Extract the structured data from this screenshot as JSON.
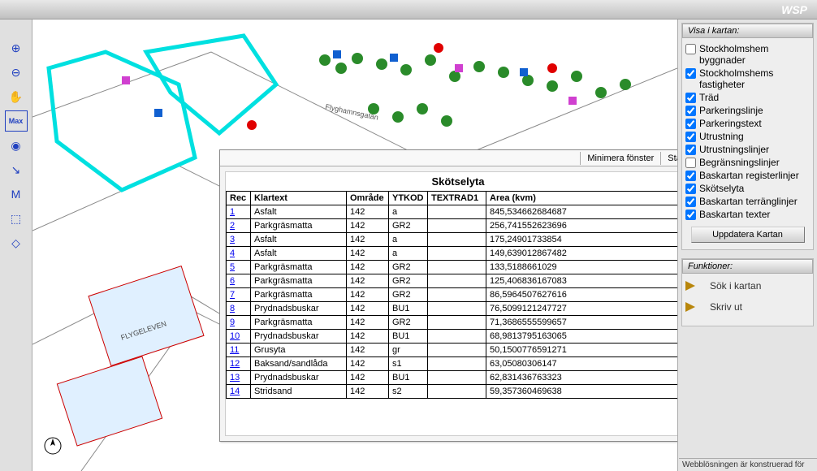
{
  "brand": "WSP",
  "tools": [
    {
      "name": "zoom-in-icon",
      "glyph": "⊕"
    },
    {
      "name": "zoom-out-icon",
      "glyph": "⊖"
    },
    {
      "name": "pan-icon",
      "glyph": "✋"
    },
    {
      "name": "max-extent-icon",
      "glyph": "Max"
    },
    {
      "name": "identify-icon",
      "glyph": "◉"
    },
    {
      "name": "select-icon",
      "glyph": "↘"
    },
    {
      "name": "measure-icon",
      "glyph": "M"
    },
    {
      "name": "info-icon",
      "glyph": "⬚"
    },
    {
      "name": "erase-icon",
      "glyph": "◇"
    }
  ],
  "window": {
    "minimize": "Minimera fönster",
    "close": "Stäng"
  },
  "table": {
    "title": "Skötselyta",
    "columns": [
      "Rec",
      "Klartext",
      "Område",
      "YTKOD",
      "TEXTRAD1",
      "Area (kvm)"
    ],
    "rows": [
      {
        "rec": "1",
        "klar": "Asfalt",
        "omr": "142",
        "yt": "a",
        "txt": "",
        "area": "845,534662684687"
      },
      {
        "rec": "2",
        "klar": "Parkgräsmatta",
        "omr": "142",
        "yt": "GR2",
        "txt": "",
        "area": "256,741552623696"
      },
      {
        "rec": "3",
        "klar": "Asfalt",
        "omr": "142",
        "yt": "a",
        "txt": "",
        "area": "175,24901733854"
      },
      {
        "rec": "4",
        "klar": "Asfalt",
        "omr": "142",
        "yt": "a",
        "txt": "",
        "area": "149,639012867482"
      },
      {
        "rec": "5",
        "klar": "Parkgräsmatta",
        "omr": "142",
        "yt": "GR2",
        "txt": "",
        "area": "133,5188661029"
      },
      {
        "rec": "6",
        "klar": "Parkgräsmatta",
        "omr": "142",
        "yt": "GR2",
        "txt": "",
        "area": "125,406836167083"
      },
      {
        "rec": "7",
        "klar": "Parkgräsmatta",
        "omr": "142",
        "yt": "GR2",
        "txt": "",
        "area": "86,5964507627616"
      },
      {
        "rec": "8",
        "klar": "Prydnadsbuskar",
        "omr": "142",
        "yt": "BU1",
        "txt": "",
        "area": "76,5099121247727"
      },
      {
        "rec": "9",
        "klar": "Parkgräsmatta",
        "omr": "142",
        "yt": "GR2",
        "txt": "",
        "area": "71,3686555599657"
      },
      {
        "rec": "10",
        "klar": "Prydnadsbuskar",
        "omr": "142",
        "yt": "BU1",
        "txt": "",
        "area": "68,9813795163065"
      },
      {
        "rec": "11",
        "klar": "Grusyta",
        "omr": "142",
        "yt": "gr",
        "txt": "",
        "area": "50,1500776591271"
      },
      {
        "rec": "12",
        "klar": "Baksand/sandlåda",
        "omr": "142",
        "yt": "s1",
        "txt": "",
        "area": "63,05080306147"
      },
      {
        "rec": "13",
        "klar": "Prydnadsbuskar",
        "omr": "142",
        "yt": "BU1",
        "txt": "",
        "area": "62,831436763323"
      },
      {
        "rec": "14",
        "klar": "Stridsand",
        "omr": "142",
        "yt": "s2",
        "txt": "",
        "area": "59,357360469638"
      }
    ]
  },
  "layers_title": "Visa i kartan:",
  "layers": [
    {
      "label": "Stockholmshem byggnader",
      "checked": false
    },
    {
      "label": "Stockholmshems fastigheter",
      "checked": true
    },
    {
      "label": "Träd",
      "checked": true
    },
    {
      "label": "Parkeringslinje",
      "checked": true
    },
    {
      "label": "Parkeringstext",
      "checked": true
    },
    {
      "label": "Utrustning",
      "checked": true
    },
    {
      "label": "Utrustningslinjer",
      "checked": true
    },
    {
      "label": "Begränsningslinjer",
      "checked": false
    },
    {
      "label": "Baskartan registerlinjer",
      "checked": true
    },
    {
      "label": "Skötselyta",
      "checked": true
    },
    {
      "label": "Baskartan terränglinjer",
      "checked": true
    },
    {
      "label": "Baskartan texter",
      "checked": true
    }
  ],
  "update_button": "Uppdatera Kartan",
  "functions_title": "Funktioner:",
  "functions": [
    {
      "label": "Sök i kartan"
    },
    {
      "label": "Skriv ut"
    }
  ],
  "footer": "Webblösningen är konstruerad för",
  "map_labels": {
    "street1": "Flyghamnsgatan",
    "area1": "FLYGELEVEN"
  }
}
